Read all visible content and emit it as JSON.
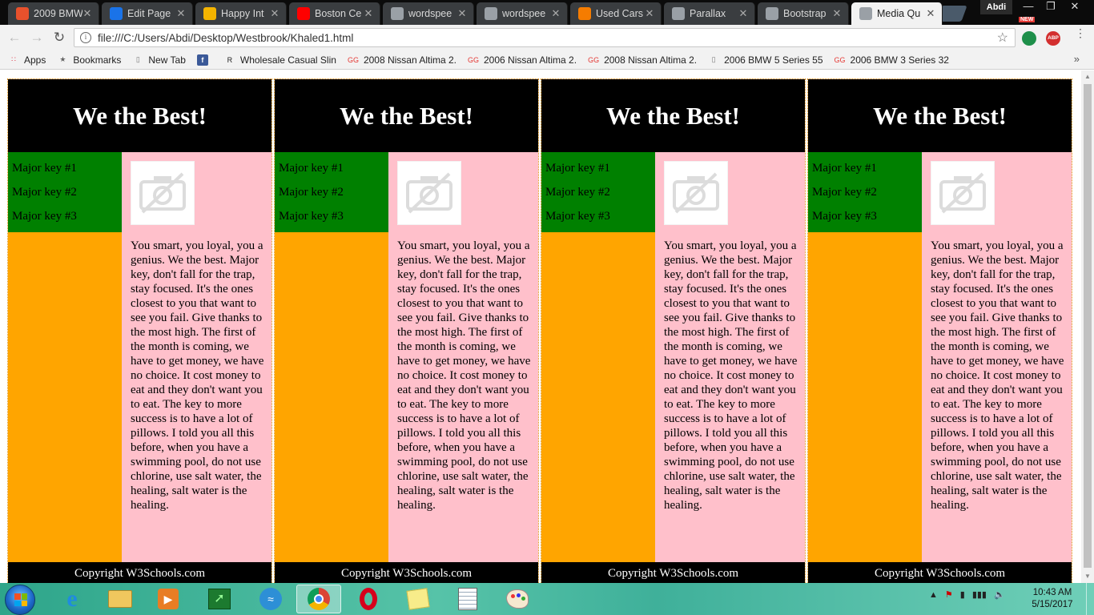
{
  "browser": {
    "tabs": [
      {
        "title": "2009 BMW",
        "icon": "gg-favicon-icon",
        "color": "#e8512c"
      },
      {
        "title": "Edit Page",
        "icon": "ag-favicon-icon",
        "color": "#1a73e8"
      },
      {
        "title": "Happy Int",
        "icon": "colorful-favicon-icon",
        "color": "#f4b400"
      },
      {
        "title": "Boston Ce",
        "icon": "youtube-icon",
        "color": "#ff0000"
      },
      {
        "title": "wordspee",
        "icon": "document-icon",
        "color": "#9aa0a6"
      },
      {
        "title": "wordspee",
        "icon": "document-icon",
        "color": "#9aa0a6"
      },
      {
        "title": "Used Cars",
        "icon": "autotrader-icon",
        "color": "#f57c00"
      },
      {
        "title": "Parallax",
        "icon": "document-icon",
        "color": "#9aa0a6"
      },
      {
        "title": "Bootstrap",
        "icon": "document-icon",
        "color": "#9aa0a6"
      },
      {
        "title": "Media Qu",
        "icon": "document-icon",
        "color": "#9aa0a6",
        "active": true
      }
    ],
    "profile_name": "Abdi",
    "url": "file:///C:/Users/Abdi/Desktop/Westbrook/Khaled1.html",
    "ext_new_badge": "NEW",
    "ext_abp_label": "ABP",
    "bookmarks": [
      {
        "label": "Apps",
        "icon": "apps-grid-icon"
      },
      {
        "label": "Bookmarks",
        "icon": "star-icon"
      },
      {
        "label": "New Tab",
        "icon": "page-icon"
      },
      {
        "label": "",
        "icon": "facebook-icon"
      },
      {
        "label": "Wholesale Casual Slin",
        "icon": "r-favicon-icon"
      },
      {
        "label": "2008 Nissan Altima 2.",
        "icon": "gg-favicon-icon"
      },
      {
        "label": "2006 Nissan Altima 2.",
        "icon": "gg-favicon-icon"
      },
      {
        "label": "2008 Nissan Altima 2.",
        "icon": "gg-favicon-icon"
      },
      {
        "label": "2006 BMW 5 Series 55",
        "icon": "page-icon"
      },
      {
        "label": "2006 BMW 3 Series 32",
        "icon": "gg-favicon-icon"
      }
    ],
    "bookmarks_more": "»"
  },
  "page": {
    "header_title": "We the Best!",
    "menu_items": [
      "Major key #1",
      "Major key #2",
      "Major key #3"
    ],
    "paragraph": "You smart, you loyal, you a genius. We the best. Major key, don't fall for the trap, stay focused. It's the ones closest to you that want to see you fail. Give thanks to the most high. The first of the month is coming, we have to get money, we have no choice. It cost money to eat and they don't want you to eat. The key to more success is to have a lot of pillows. I told you all this before, when you have a swimming pool, do not use chlorine, use salt water, the healing, salt water is the healing.",
    "footer_text": "Copyright W3Schools.com",
    "panel_count": 4,
    "colors": {
      "header_bg": "#000000",
      "menu_bg": "#008000",
      "sidebar_bg": "#ffa500",
      "content_bg": "#ffc0cb",
      "footer_bg": "#000000",
      "panel_border": "#e08a00"
    }
  },
  "taskbar": {
    "apps": [
      {
        "name": "internet-explorer-icon"
      },
      {
        "name": "file-explorer-icon"
      },
      {
        "name": "media-player-icon"
      },
      {
        "name": "task-manager-icon"
      },
      {
        "name": "network-icon"
      },
      {
        "name": "chrome-icon",
        "active": true
      },
      {
        "name": "opera-icon"
      },
      {
        "name": "sticky-notes-icon"
      },
      {
        "name": "notepad-icon"
      },
      {
        "name": "paint-icon"
      }
    ],
    "time": "10:43 AM",
    "date": "5/15/2017"
  }
}
